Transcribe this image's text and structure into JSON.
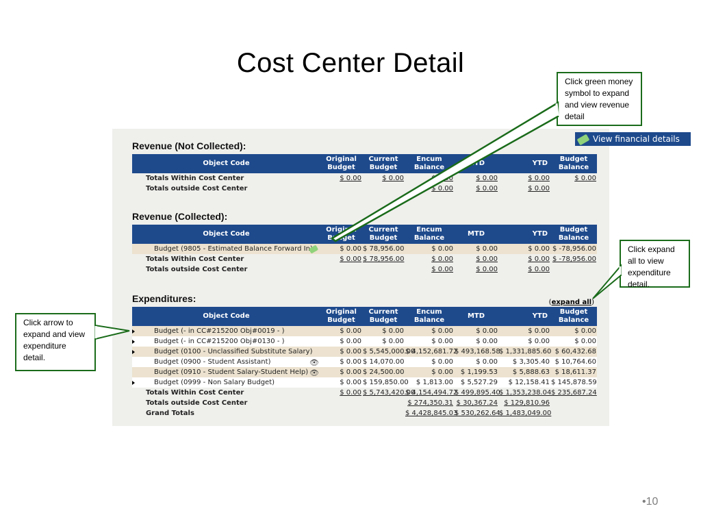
{
  "slide": {
    "title": "Cost Center Detail",
    "page_number": "10"
  },
  "view_financial_details": "View financial details",
  "callouts": {
    "money": "Click green money symbol to expand and view revenue detail",
    "expand_all": "Click expand all to view expenditure detail.",
    "arrow": "Click arrow to expand and view expenditure detail."
  },
  "colors": {
    "header_bg": "#1e4a8c",
    "row_tan": "#ece2cf",
    "callout_border": "#1a6b1a"
  },
  "columns": {
    "object_code": "Object Code",
    "original_budget_1": "Original",
    "original_budget_2": "Budget",
    "current_budget_1": "Current",
    "current_budget_2": "Budget",
    "encum_balance_1": "Encum",
    "encum_balance_2": "Balance",
    "mtd": "MTD",
    "ytd": "YTD",
    "budget_balance_1": "Budget",
    "budget_balance_2": "Balance"
  },
  "rev_not_collected": {
    "title": "Revenue (Not Collected):",
    "rows": [
      {
        "label": "Totals Within Cost Center",
        "original": "$ 0.00",
        "current": "$ 0.00",
        "encum": "$ 0.00",
        "mtd": "$ 0.00",
        "ytd": "$ 0.00",
        "balance": "$ 0.00"
      },
      {
        "label": "Totals outside Cost Center",
        "original": "",
        "current": "",
        "encum": "$ 0.00",
        "mtd": "$ 0.00",
        "ytd": "$ 0.00",
        "balance": ""
      }
    ]
  },
  "rev_collected": {
    "title": "Revenue (Collected):",
    "items": [
      {
        "label": "Budget (9805 - Estimated Balance Forward In)",
        "icon": "money-icon",
        "original": "$ 0.00",
        "current": "$ 78,956.00",
        "encum": "$ 0.00",
        "mtd": "$ 0.00",
        "ytd": "$ 0.00",
        "balance": "$ -78,956.00"
      }
    ],
    "rows": [
      {
        "label": "Totals Within Cost Center",
        "original": "$ 0.00",
        "current": "$ 78,956.00",
        "encum": "$ 0.00",
        "mtd": "$ 0.00",
        "ytd": "$ 0.00",
        "balance": "$ -78,956.00"
      },
      {
        "label": "Totals outside Cost Center",
        "original": "",
        "current": "",
        "encum": "$ 0.00",
        "mtd": "$ 0.00",
        "ytd": "$ 0.00",
        "balance": ""
      }
    ]
  },
  "expenditures": {
    "title": "Expenditures:",
    "expand_all_open": "(",
    "expand_all": "expand all",
    "expand_all_close": ")",
    "items": [
      {
        "label": "Budget (- in CC#215200 Obj#0019 - )",
        "arrow": true,
        "icon": "",
        "original": "$ 0.00",
        "current": "$ 0.00",
        "encum": "$ 0.00",
        "mtd": "$ 0.00",
        "ytd": "$ 0.00",
        "balance": "$ 0.00"
      },
      {
        "label": "Budget (- in CC#215200 Obj#0130 - )",
        "arrow": true,
        "icon": "",
        "original": "$ 0.00",
        "current": "$ 0.00",
        "encum": "$ 0.00",
        "mtd": "$ 0.00",
        "ytd": "$ 0.00",
        "balance": "$ 0.00"
      },
      {
        "label": "Budget (0100 - Unclassified Substitute Salary)",
        "arrow": true,
        "icon": "",
        "original": "$ 0.00",
        "current": "$ 5,545,000.00",
        "encum": "$ 4,152,681.72",
        "mtd": "$ 493,168.58",
        "ytd": "$ 1,331,885.60",
        "balance": "$ 60,432.68"
      },
      {
        "label": "Budget (0900 - Student Assistant)",
        "arrow": false,
        "icon": "binoculars-icon",
        "original": "$ 0.00",
        "current": "$ 14,070.00",
        "encum": "$ 0.00",
        "mtd": "$ 0.00",
        "ytd": "$ 3,305.40",
        "balance": "$ 10,764.60"
      },
      {
        "label": "Budget (0910 - Student Salary-Student Help)",
        "arrow": false,
        "icon": "binoculars-icon",
        "original": "$ 0.00",
        "current": "$ 24,500.00",
        "encum": "$ 0.00",
        "mtd": "$ 1,199.53",
        "ytd": "$ 5,888.63",
        "balance": "$ 18,611.37"
      },
      {
        "label": "Budget (0999 - Non Salary Budget)",
        "arrow": true,
        "icon": "",
        "original": "$ 0.00",
        "current": "$ 159,850.00",
        "encum": "$ 1,813.00",
        "mtd": "$ 5,527.29",
        "ytd": "$ 12,158.41",
        "balance": "$ 145,878.59"
      }
    ],
    "rows": [
      {
        "label": "Totals Within Cost Center",
        "original": "$ 0.00",
        "current": "$ 5,743,420.00",
        "encum": "$ 4,154,494.72",
        "mtd": "$ 499,895.40",
        "ytd": "$ 1,353,238.04",
        "balance": "$ 235,687.24"
      },
      {
        "label": "Totals outside Cost Center",
        "original": "",
        "current": "",
        "encum": "$ 274,350.31",
        "mtd": "$ 30,367.24",
        "ytd": "$ 129,810.96",
        "balance": ""
      },
      {
        "label": "Grand Totals",
        "original": "",
        "current": "",
        "encum": "$ 4,428,845.03",
        "mtd": "$ 530,262.64",
        "ytd": "$ 1,483,049.00",
        "balance": ""
      }
    ]
  }
}
